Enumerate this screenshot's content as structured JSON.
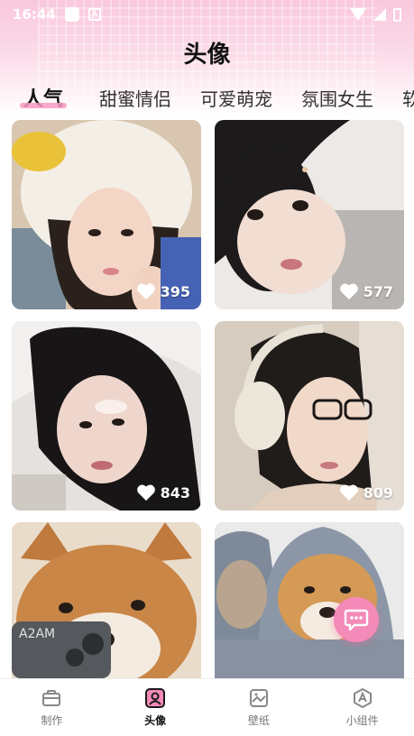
{
  "status_bar": {
    "time": "16:44"
  },
  "header": {
    "title": "头像"
  },
  "tabs": [
    {
      "label": "人气",
      "active": true
    },
    {
      "label": "甜蜜情侣",
      "active": false
    },
    {
      "label": "可爱萌宠",
      "active": false
    },
    {
      "label": "氛围女生",
      "active": false
    },
    {
      "label": "软",
      "active": false
    }
  ],
  "cards": [
    {
      "photo": "girl-white-hood",
      "likes": "395"
    },
    {
      "photo": "girl-lying-gray-scarf",
      "likes": "577"
    },
    {
      "photo": "girl-lying-white-sheets",
      "likes": "843"
    },
    {
      "photo": "girl-headphones-glasses",
      "likes": "809"
    },
    {
      "photo": "shiba-dog-with-phone",
      "likes": ""
    },
    {
      "photo": "two-shiba-dogs-in-hoodie",
      "likes": ""
    }
  ],
  "fab": {
    "icon": "chat-bubble-icon"
  },
  "bottom_nav": [
    {
      "label": "制作",
      "icon": "toolbox-icon",
      "active": false
    },
    {
      "label": "头像",
      "icon": "avatar-icon",
      "active": true
    },
    {
      "label": "壁纸",
      "icon": "wallpaper-icon",
      "active": false
    },
    {
      "label": "小组件",
      "icon": "widget-icon",
      "active": false
    }
  ],
  "colors": {
    "accent": "#f48ab8",
    "tab_underline": "#f79ac0",
    "header_bg": "#f9c8dd"
  }
}
